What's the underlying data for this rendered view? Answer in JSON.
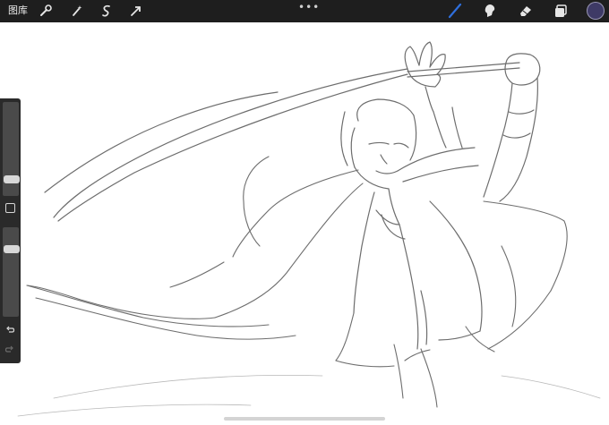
{
  "topbar": {
    "gallery_label": "图库",
    "left_tools": [
      "wrench-icon",
      "magic-wand-icon",
      "selection-icon",
      "transform-arrow-icon"
    ],
    "handle_glyph": "•••",
    "right_tools": [
      "brush-icon",
      "smudge-icon",
      "eraser-icon",
      "layers-icon"
    ],
    "active_tool": "brush-icon",
    "current_color": "#3e3a66",
    "brush_accent": "#2f6fdc"
  },
  "sidebar": {
    "size_slider_level": 0.78,
    "opacity_slider_level": 0.12,
    "buttons": [
      "modify-button",
      "undo-icon",
      "redo-icon"
    ]
  },
  "canvas": {
    "background": "#ffffff",
    "stroke_color": "#6d6d6d"
  }
}
